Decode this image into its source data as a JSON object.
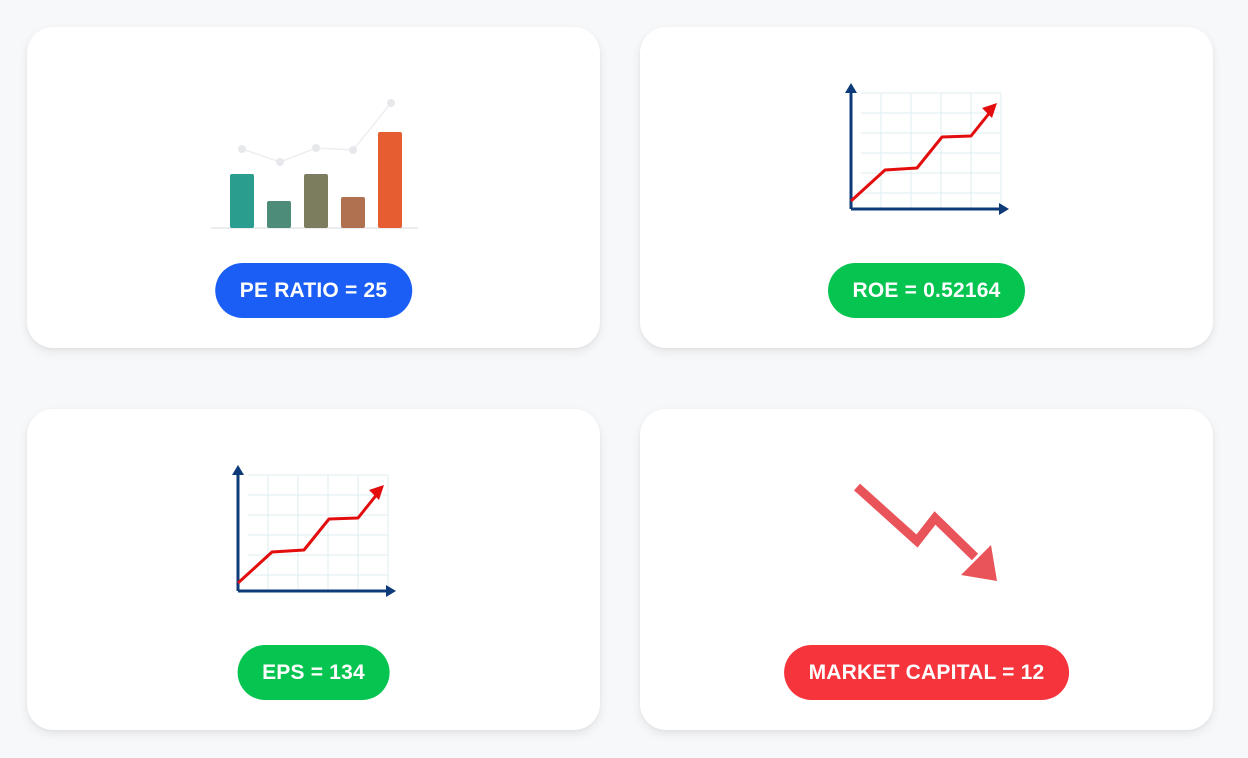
{
  "cards": {
    "pe": {
      "label": "PE RATIO = 25",
      "color": "#1a5ef5",
      "icon": "bar-chart-icon"
    },
    "roe": {
      "label": "ROE = 0.52164",
      "color": "#06c450",
      "icon": "line-chart-up-icon"
    },
    "eps": {
      "label": "EPS = 134",
      "color": "#06c450",
      "icon": "line-chart-up-icon"
    },
    "market_capital": {
      "label": "MARKET CAPITAL = 12",
      "color": "#f5343c",
      "icon": "trend-down-arrow-icon"
    }
  }
}
